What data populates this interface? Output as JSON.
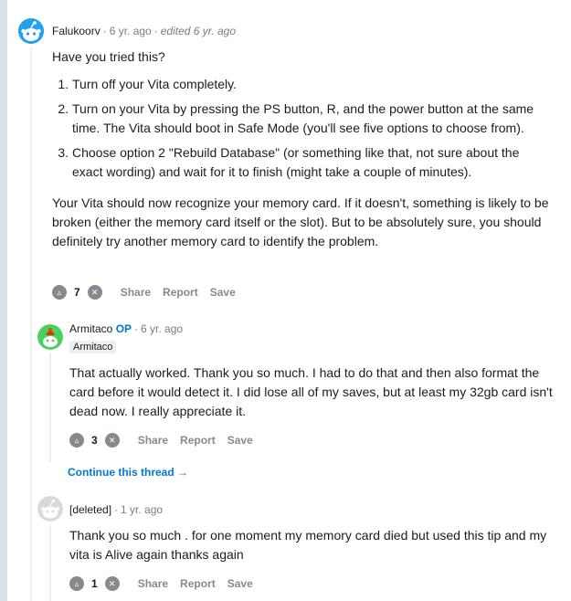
{
  "comments": [
    {
      "username": "Falukoorv",
      "time": "6 yr. ago",
      "edited": "edited 6 yr. ago",
      "intro": "Have you tried this?",
      "steps": [
        "Turn off your Vita completely.",
        "Turn on your Vita by pressing the PS button, R, and the power button at the same time. The Vita should boot in Safe Mode (you'll see five options to choose from).",
        "Choose option 2 \"Rebuild Database\" (or something like that, not sure about the exact wording) and wait for it to finish (might take a couple of minutes)."
      ],
      "outro": "Your Vita should now recognize your memory card. If it doesn't, something is likely to be broken (either the memory card itself or the slot). But to be absolutely sure, you should definitely try another memory card to identify the problem.",
      "score": "7",
      "actions": [
        "Share",
        "Report",
        "Save"
      ]
    },
    {
      "username": "Armitaco",
      "op_badge": "OP",
      "time": "6 yr. ago",
      "flair": "Armitaco",
      "text": "That actually worked. Thank you so much. I had to do that and then also format the card before it would detect it. I did lose all of my saves, but at least my 32gb card isn't dead now. I really appreciate it.",
      "score": "3",
      "actions": [
        "Share",
        "Report",
        "Save"
      ],
      "continue_label": "Continue this thread"
    },
    {
      "username": "[deleted]",
      "time": "1 yr. ago",
      "text": "Thank you so much . for one moment my memory card died but used this tip and my vita is Alive again thanks again",
      "score": "1",
      "actions": [
        "Share",
        "Report",
        "Save"
      ]
    }
  ],
  "icons": {
    "upvote": "upvote-icon",
    "downvote": "downvote-icon",
    "arrow": "arrow-right-icon",
    "avatar": "snoo-avatar-icon"
  },
  "colors": {
    "link": "#0079d3",
    "avatar_blue": "#24a0ed",
    "avatar_green": "#46d160",
    "avatar_deleted": "#d7dadc"
  }
}
